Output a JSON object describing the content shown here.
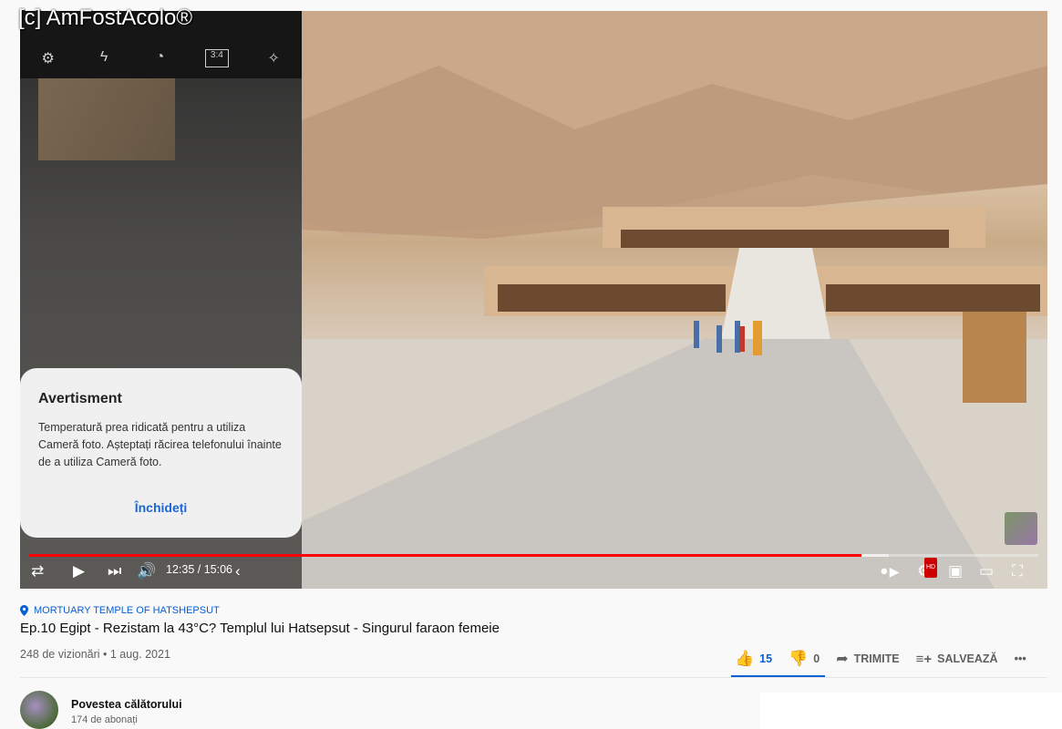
{
  "watermark": "[c] AmFostAcolo®",
  "player": {
    "camera_icons": [
      "settings-icon",
      "flash-off-icon",
      "timer-icon",
      "aspect-ratio-icon",
      "effects-icon"
    ],
    "camera_aspect_label": "3:4",
    "dialog": {
      "title": "Avertisment",
      "message": "Temperatură prea ridicată pentru a utiliza Cameră foto. Așteptați răcirea telefonului înainte de a utiliza Cameră foto.",
      "button": "Închideți"
    },
    "progress": {
      "played_fraction": 0.825,
      "buffered_fraction": 0.852
    },
    "time": "12:35 / 15:06",
    "hd_badge": "HD",
    "colors": {
      "progress": "#ff0000",
      "accent": "#065fd4"
    }
  },
  "video": {
    "location": "MORTUARY TEMPLE OF HATSHEPSUT",
    "title": "Ep.10 Egipt - Rezistam la 43°C? Templul lui Hatsepsut - Singurul faraon femeie",
    "views_date": "248 de vizionări • 1 aug. 2021",
    "likes": "15",
    "dislikes": "0",
    "share_label": "TRIMITE",
    "save_label": "SALVEAZĂ",
    "more_label": "•••"
  },
  "channel": {
    "name": "Povestea călătorului",
    "subscribers": "174 de abonați"
  }
}
